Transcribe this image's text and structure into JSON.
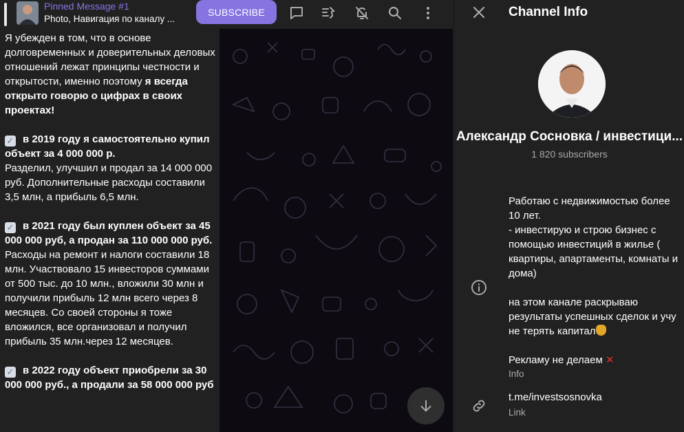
{
  "header": {
    "pinned_title": "Pinned Message #1",
    "pinned_subtitle": "Photo, Навигация по каналу ...",
    "subscribe_label": "SUBSCRIBE"
  },
  "message": {
    "intro_1": "Я убежден в том, что в основе долговременных и доверительных деловых отношений лежат принципы честности и открытости, именно поэтому ",
    "intro_bold": "я всегда открыто говорю о цифрах в своих проектах!",
    "b1_bold": "в 2019 году я самостоятельно купил объект за 4 000 000 р.",
    "b1_text": "Разделил, улучшил и продал за 14 000 000 руб. Дополнительные расходы составили 3,5 млн, а прибыль 6,5 млн.",
    "b2_bold": "в 2021 году был куплен объект за 45 000 000 руб, а продан за 110 000 000 руб.",
    "b2_text": "Расходы на ремонт и налоги составили 18 млн. Участвовало 15 инвесторов суммами от 500 тыс. до 10 млн., вложили 30 млн и получили прибыль 12 млн всего через 8 месяцев. Со своей стороны я тоже вложился, все организовал и получил прибыль 35 млн.через 12 месяцев.",
    "b3_bold": "в 2022 году объект приобрели за 30 000 000 руб., а продали за 58 000 000 руб"
  },
  "panel": {
    "title": "Channel Info",
    "channel_name": "Александр Сосновка / инвестици...",
    "subscribers": "1 820 subscribers",
    "about_main": "Работаю с недвижимостью более 10 лет.\n- инвестирую и строю бизнес с помощью инвестиций в жилье ( квартиры, апартаменты, комнаты и дома)\n\nна этом канале раскрываю результаты успешных сделок и учу не терять капитал",
    "about_ads": "Рекламу не делаем",
    "about_label": "Info",
    "link": "t.me/investsosnovka",
    "link_label": "Link"
  },
  "colors": {
    "accent": "#8774e1",
    "background": "#212121",
    "wallpaper": "#0d0b11",
    "secondary_text": "#aaaaaa"
  }
}
